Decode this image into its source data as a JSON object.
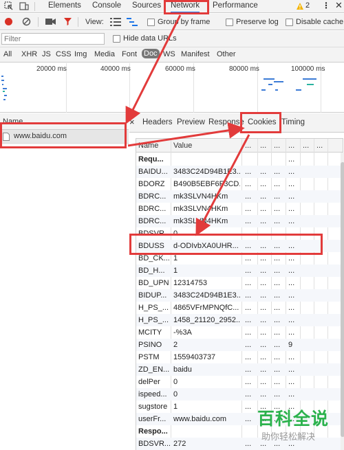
{
  "devtools": {
    "tabs": [
      {
        "label": "Elements"
      },
      {
        "label": "Console"
      },
      {
        "label": "Sources"
      },
      {
        "label": "Network"
      },
      {
        "label": "Performance"
      }
    ],
    "warning_count": "2",
    "toolbar": {
      "view_label": "View:",
      "group_by_frame_label": "Group by frame",
      "preserve_log_label": "Preserve log",
      "disable_cache_label": "Disable cache"
    },
    "filter": {
      "placeholder": "Filter",
      "hide_data_urls_label": "Hide data URLs"
    },
    "type_filters": [
      "All",
      "XHR",
      "JS",
      "CSS",
      "Img",
      "Media",
      "Font",
      "Doc",
      "WS",
      "Manifest",
      "Other"
    ],
    "active_type_filter": "Doc",
    "overview_ticks": [
      "20000 ms",
      "40000 ms",
      "60000 ms",
      "80000 ms",
      "100000 ms"
    ]
  },
  "request_list": {
    "header": "Name",
    "requests": [
      {
        "name": "www.baidu.com"
      }
    ]
  },
  "detail": {
    "close_icon": "×",
    "tabs": [
      {
        "label": "Headers"
      },
      {
        "label": "Preview"
      },
      {
        "label": "Response"
      },
      {
        "label": "Cookies"
      },
      {
        "label": "Timing"
      }
    ],
    "active_tab": "Cookies",
    "columns": [
      "Name",
      "Value",
      "...",
      "...",
      "...",
      "...",
      "...",
      "..."
    ],
    "cookies": [
      {
        "name": "Requ...",
        "value": "",
        "c3": "",
        "c4": "",
        "c5": "",
        "c6": "...",
        "c7": "",
        "bold": true
      },
      {
        "name": "BAIDU...",
        "value": "3483C24D94B1E3...",
        "c3": "...",
        "c4": "...",
        "c5": "...",
        "c6": "...",
        "c7": ""
      },
      {
        "name": "BDORZ",
        "value": "B490B5EBF6F3CD...",
        "c3": "...",
        "c4": "...",
        "c5": "...",
        "c6": "...",
        "c7": ""
      },
      {
        "name": "BDRC...",
        "value": "mk3SLVN4HKm",
        "c3": "...",
        "c4": "...",
        "c5": "...",
        "c6": "...",
        "c7": ""
      },
      {
        "name": "BDRC...",
        "value": "mk3SLVN4HKm",
        "c3": "...",
        "c4": "...",
        "c5": "...",
        "c6": "...",
        "c7": ""
      },
      {
        "name": "BDRC...",
        "value": "mk3SLVN4HKm",
        "c3": "...",
        "c4": "...",
        "c5": "...",
        "c6": "...",
        "c7": ""
      },
      {
        "name": "BDSVR...",
        "value": "0",
        "c3": "...",
        "c4": "...",
        "c5": "...",
        "c6": "...",
        "c7": ""
      },
      {
        "name": "BDUSS",
        "value": "d-ODIvbXA0UHR...",
        "c3": "...",
        "c4": "...",
        "c5": "...",
        "c6": "...",
        "c7": ""
      },
      {
        "name": "BD_CK...",
        "value": "1",
        "c3": "...",
        "c4": "...",
        "c5": "...",
        "c6": "...",
        "c7": ""
      },
      {
        "name": "BD_H...",
        "value": "1",
        "c3": "...",
        "c4": "...",
        "c5": "...",
        "c6": "...",
        "c7": ""
      },
      {
        "name": "BD_UPN",
        "value": "12314753",
        "c3": "...",
        "c4": "...",
        "c5": "...",
        "c6": "...",
        "c7": ""
      },
      {
        "name": "BIDUP...",
        "value": "3483C24D94B1E3...",
        "c3": "...",
        "c4": "...",
        "c5": "...",
        "c6": "...",
        "c7": ""
      },
      {
        "name": "H_PS_...",
        "value": "4865VFrMPNQfC...",
        "c3": "...",
        "c4": "...",
        "c5": "...",
        "c6": "...",
        "c7": ""
      },
      {
        "name": "H_PS_...",
        "value": "1458_21120_2952...",
        "c3": "...",
        "c4": "...",
        "c5": "...",
        "c6": "...",
        "c7": ""
      },
      {
        "name": "MCITY",
        "value": "-%3A",
        "c3": "...",
        "c4": "...",
        "c5": "...",
        "c6": "...",
        "c7": ""
      },
      {
        "name": "PSINO",
        "value": "2",
        "c3": "...",
        "c4": "...",
        "c5": "...",
        "c6": "9",
        "c7": ""
      },
      {
        "name": "PSTM",
        "value": "1559403737",
        "c3": "...",
        "c4": "...",
        "c5": "...",
        "c6": "...",
        "c7": ""
      },
      {
        "name": "ZD_EN...",
        "value": "baidu",
        "c3": "...",
        "c4": "...",
        "c5": "...",
        "c6": "...",
        "c7": ""
      },
      {
        "name": "delPer",
        "value": "0",
        "c3": "...",
        "c4": "...",
        "c5": "...",
        "c6": "...",
        "c7": ""
      },
      {
        "name": "ispeed...",
        "value": "0",
        "c3": "...",
        "c4": "...",
        "c5": "...",
        "c6": "...",
        "c7": ""
      },
      {
        "name": "sugstore",
        "value": "1",
        "c3": "...",
        "c4": "...",
        "c5": "...",
        "c6": "...",
        "c7": ""
      },
      {
        "name": "userFr...",
        "value": "www.baidu.com",
        "c3": "...",
        "c4": "...",
        "c5": "...",
        "c6": "...",
        "c7": ""
      },
      {
        "name": "Respo...",
        "value": "",
        "c3": "",
        "c4": "",
        "c5": "",
        "c6": "",
        "c7": "",
        "bold": true
      },
      {
        "name": "BDSVR...",
        "value": "272",
        "c3": "...",
        "c4": "...",
        "c5": "...",
        "c6": "...",
        "c7": ""
      }
    ]
  },
  "watermark": {
    "title": "百科全说",
    "subtitle": "助你轻松解决"
  },
  "colors": {
    "annotation_red": "#e23b3b",
    "record_red": "#d93025",
    "accent_blue": "#1a73e8",
    "watermark_green": "#2bb24c"
  }
}
